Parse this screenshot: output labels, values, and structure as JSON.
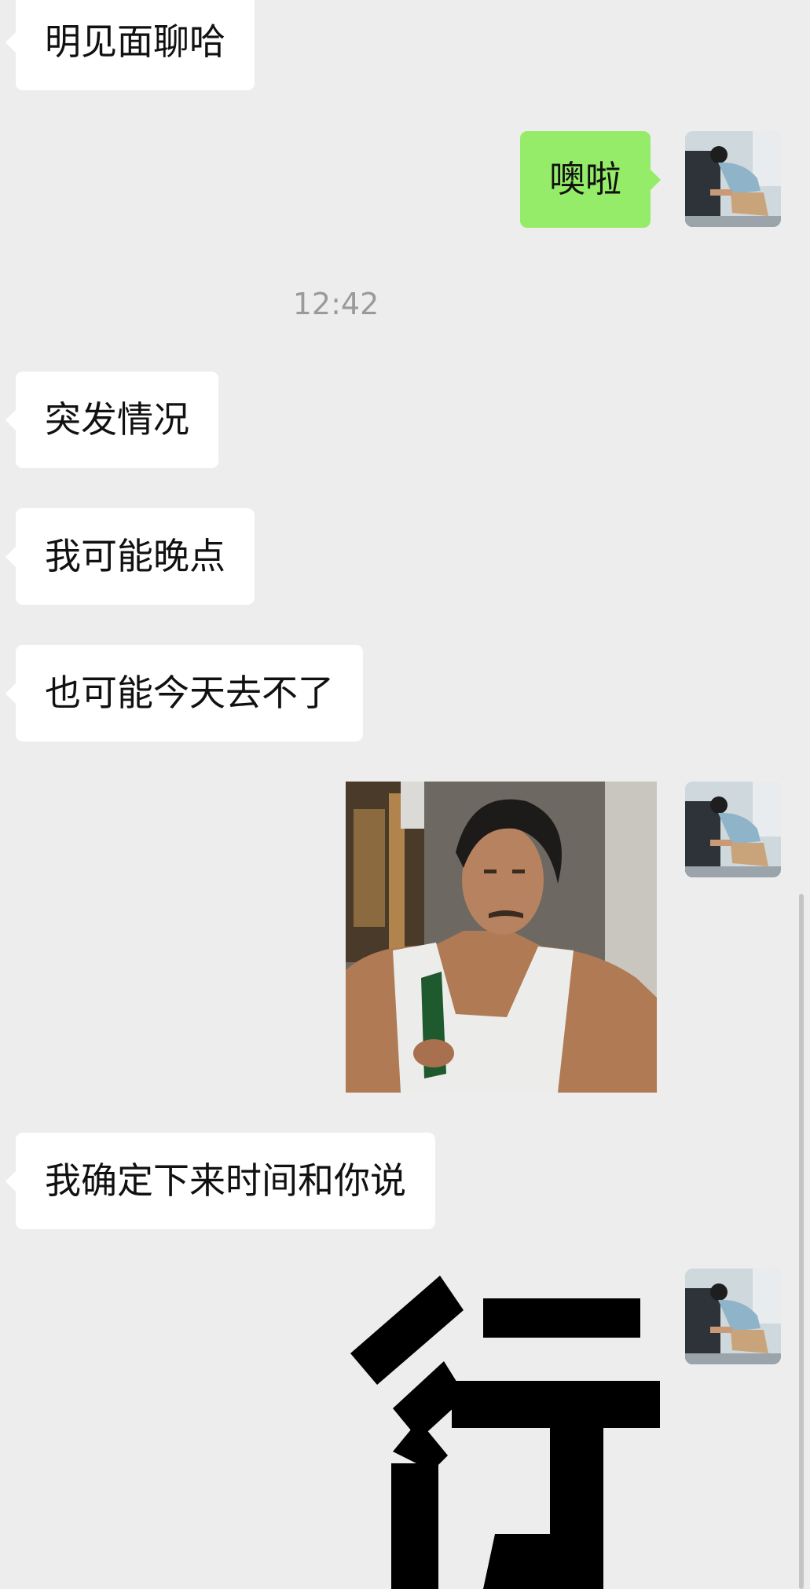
{
  "chat": {
    "messages": [
      {
        "side": "left",
        "type": "text",
        "text": "明见面聊哈"
      },
      {
        "side": "right",
        "type": "text",
        "text": "噢啦",
        "avatar_icon": "user-avatar-icon"
      },
      {
        "type": "timestamp",
        "text": "12:42"
      },
      {
        "side": "left",
        "type": "text",
        "text": "突发情况"
      },
      {
        "side": "left",
        "type": "text",
        "text": "我可能晚点"
      },
      {
        "side": "left",
        "type": "text",
        "text": "也可能今天去不了"
      },
      {
        "side": "right",
        "type": "image",
        "content": "man in white tank top holding green bottle",
        "avatar_icon": "user-avatar-icon"
      },
      {
        "side": "left",
        "type": "text",
        "text": "我确定下来时间和你说"
      },
      {
        "side": "right",
        "type": "sticker",
        "text": "行",
        "avatar_icon": "user-avatar-icon"
      }
    ]
  },
  "colors": {
    "background": "#ededed",
    "received_bubble": "#ffffff",
    "sent_bubble": "#95ec69",
    "timestamp_text": "#9a9a9a"
  }
}
